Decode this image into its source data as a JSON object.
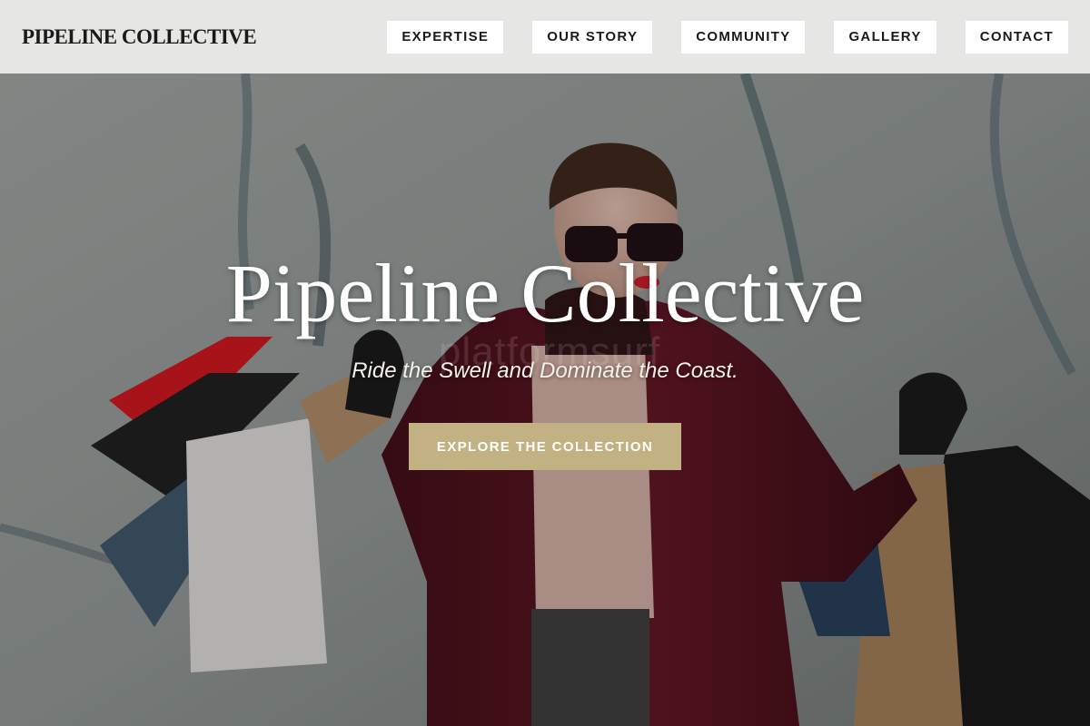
{
  "header": {
    "brand": "PIPELINE COLLECTIVE",
    "nav": [
      {
        "label": "EXPERTISE"
      },
      {
        "label": "OUR STORY"
      },
      {
        "label": "COMMUNITY"
      },
      {
        "label": "GALLERY"
      },
      {
        "label": "CONTACT"
      }
    ]
  },
  "hero": {
    "title": "Pipeline Collective",
    "tagline": "Ride the Swell and Dominate the Coast.",
    "cta_label": "EXPLORE THE COLLECTION",
    "watermark": "platformsurf",
    "image_subject": "woman-with-shopping-bags-photo"
  },
  "colors": {
    "header_bg": "#e6e6e4",
    "nav_button_bg": "#ffffff",
    "cta_bg": "#c2b283",
    "coat": "#5a0f1c"
  }
}
